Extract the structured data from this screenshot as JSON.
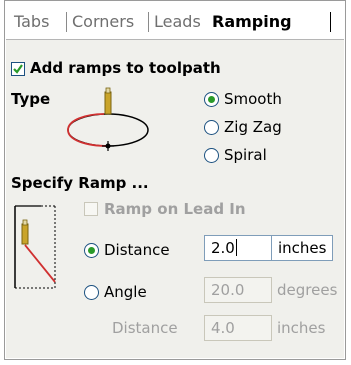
{
  "tabs": [
    {
      "label": "Tabs"
    },
    {
      "label": "Corners"
    },
    {
      "label": "Leads"
    },
    {
      "label": "Ramping"
    }
  ],
  "add_ramps": {
    "label": "Add ramps to toolpath",
    "checked": true
  },
  "type": {
    "heading": "Type",
    "options": [
      {
        "label": "Smooth",
        "selected": true
      },
      {
        "label": "Zig Zag",
        "selected": false
      },
      {
        "label": "Spiral",
        "selected": false
      }
    ]
  },
  "specify": {
    "heading": "Specify Ramp ...",
    "ramp_on_lead_in": {
      "label": "Ramp on Lead In",
      "checked": false,
      "enabled": false
    },
    "distance": {
      "label": "Distance",
      "selected": true,
      "value": "2.0",
      "unit": "inches"
    },
    "angle": {
      "label": "Angle",
      "selected": false,
      "value": "20.0",
      "unit": "degrees"
    },
    "angle_distance": {
      "label": "Distance",
      "value": "4.0",
      "unit": "inches"
    }
  },
  "colors": {
    "accent": "#1c5180",
    "radio_dot": "#2a9a2a",
    "tool": "#c9a42a",
    "path": "#d03030"
  }
}
